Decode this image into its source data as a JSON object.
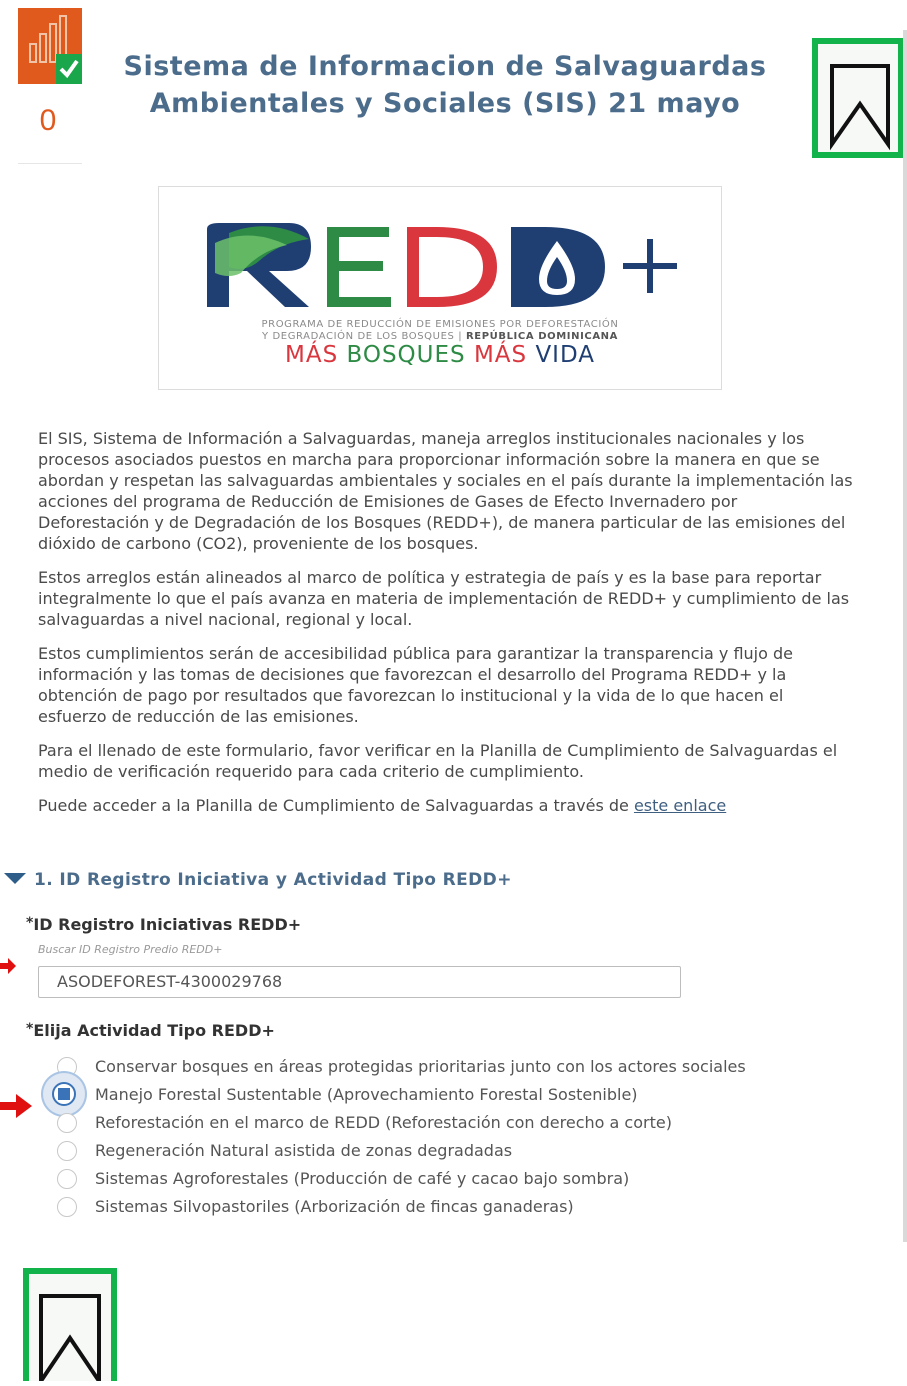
{
  "header": {
    "title": "Sistema de Informacion de Salvaguardas Ambientales y Sociales (SIS) 21 mayo",
    "status_count": "0",
    "status_icon": "bar-chart-check-icon",
    "bookmark_icon": "bookmark-icon"
  },
  "logo": {
    "wordmark": "REDD+",
    "subtitle_line1": "PROGRAMA DE REDUCCIÓN DE EMISIONES POR DEFORESTACIÓN",
    "subtitle_line2a": "Y DEGRADACIÓN DE LOS BOSQUES | ",
    "subtitle_line2b": "REPÚBLICA DOMINICANA",
    "slogan_red1": "MÁS ",
    "slogan_green1": "BOSQUES ",
    "slogan_red2": "MÁS ",
    "slogan_blue": "VIDA"
  },
  "intro": {
    "p1": "El SIS, Sistema de Información a Salvaguardas, maneja arreglos institucionales nacionales y los procesos asociados puestos en marcha para proporcionar información sobre la manera en que se abordan y respetan las salvaguardas ambientales y sociales en el país durante la implementación las acciones del programa de Reducción de Emisiones de Gases de Efecto Invernadero por Deforestación y de Degradación de los Bosques (REDD+), de manera particular de las emisiones del dióxido de carbono (CO2), proveniente de los bosques.",
    "p2": "Estos arreglos están alineados al marco de política y estrategia de país y es la base para reportar integralmente lo que el país avanza en materia de implementación de REDD+ y cumplimiento de las salvaguardas a nivel nacional, regional y local.",
    "p3": "Estos cumplimientos serán de accesibilidad pública para garantizar la transparencia y flujo de información y las tomas de decisiones que favorezcan el desarrollo del Programa REDD+ y la obtención de pago por resultados que favorezcan lo institucional y la vida de lo que hacen el esfuerzo de reducción de las emisiones.",
    "p4": "Para el llenado de este formulario, favor verificar en la Planilla de Cumplimiento de Salvaguardas el medio de verificación requerido para cada criterio de cumplimiento.",
    "p5": "Puede acceder a la Planilla de Cumplimiento de Salvaguardas a través de ",
    "link": "este enlace"
  },
  "section": {
    "title": "1. ID Registro Iniciativa y Actividad Tipo REDD+"
  },
  "id_field": {
    "required_mark": "*",
    "label": "ID Registro Iniciativas REDD+",
    "hint": "Buscar ID Registro Predio REDD+",
    "value": "ASODEFOREST-4300029768"
  },
  "activity_field": {
    "required_mark": "*",
    "label": "Elija Actividad Tipo REDD+",
    "options": [
      "Conservar bosques en áreas protegidas prioritarias junto con los actores sociales",
      "Manejo Forestal Sustentable (Aprovechamiento Forestal Sostenible)",
      "Reforestación en el marco de REDD (Reforestación con derecho a corte)",
      "Regeneración Natural asistida de zonas degradadas",
      "Sistemas Agroforestales (Producción de café y cacao bajo sombra)",
      "Sistemas Silvopastoriles (Arborización de fincas ganaderas)"
    ],
    "selected_index": 1
  },
  "colors": {
    "accent": "#4c6c8c",
    "status_orange": "#e0591d",
    "bookmark_green": "#12b34a",
    "logo_green": "#2e8b46",
    "logo_red": "#d9363e",
    "logo_navy": "#1f3f73"
  }
}
